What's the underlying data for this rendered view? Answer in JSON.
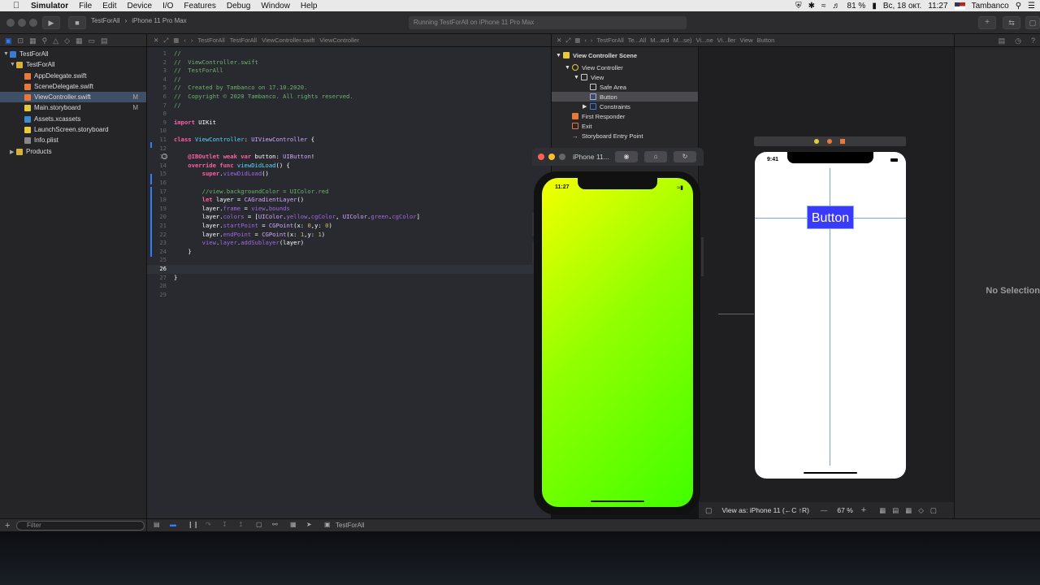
{
  "menubar": {
    "app": "Simulator",
    "items": [
      "File",
      "Edit",
      "Device",
      "I/O",
      "Features",
      "Debug",
      "Window",
      "Help"
    ],
    "battery": "81 %",
    "date": "Вс, 18 окт.",
    "time": "11:27",
    "user": "Tambanco"
  },
  "toolbar": {
    "scheme": "TestForAll",
    "device": "iPhone 11 Pro Max",
    "status": "Running TestForAll on iPhone 11 Pro Max"
  },
  "navigator": {
    "project": "TestForAll",
    "group": "TestForAll",
    "files": [
      {
        "name": "AppDelegate.swift",
        "badge": ""
      },
      {
        "name": "SceneDelegate.swift",
        "badge": ""
      },
      {
        "name": "ViewController.swift",
        "badge": "M"
      },
      {
        "name": "Main.storyboard",
        "badge": "M"
      },
      {
        "name": "Assets.xcassets",
        "badge": ""
      },
      {
        "name": "LaunchScreen.storyboard",
        "badge": ""
      },
      {
        "name": "Info.plist",
        "badge": ""
      }
    ],
    "products": "Products",
    "filter_placeholder": "Filter"
  },
  "editor": {
    "breadcrumb": [
      "TestForAll",
      "TestForAll",
      "ViewController.swift",
      "ViewController"
    ]
  },
  "ib": {
    "breadcrumb": [
      "TestForAll",
      "Te...All",
      "M...ard",
      "M...se)",
      "Vi...ne",
      "Vi...ller",
      "View",
      "Button"
    ],
    "outline": [
      "View Controller Scene",
      "View Controller",
      "View",
      "Safe Area",
      "Button",
      "Constraints",
      "First Responder",
      "Exit",
      "Storyboard Entry Point"
    ],
    "scene_time": "9:41",
    "button_label": "Button",
    "view_as": "View as: iPhone 11 (←C ↑R)",
    "zoom": "67 %",
    "no_selection": "No Selection"
  },
  "simulator": {
    "title": "iPhone 11...",
    "time": "11:27"
  },
  "debug": {
    "target": "TestForAll"
  }
}
